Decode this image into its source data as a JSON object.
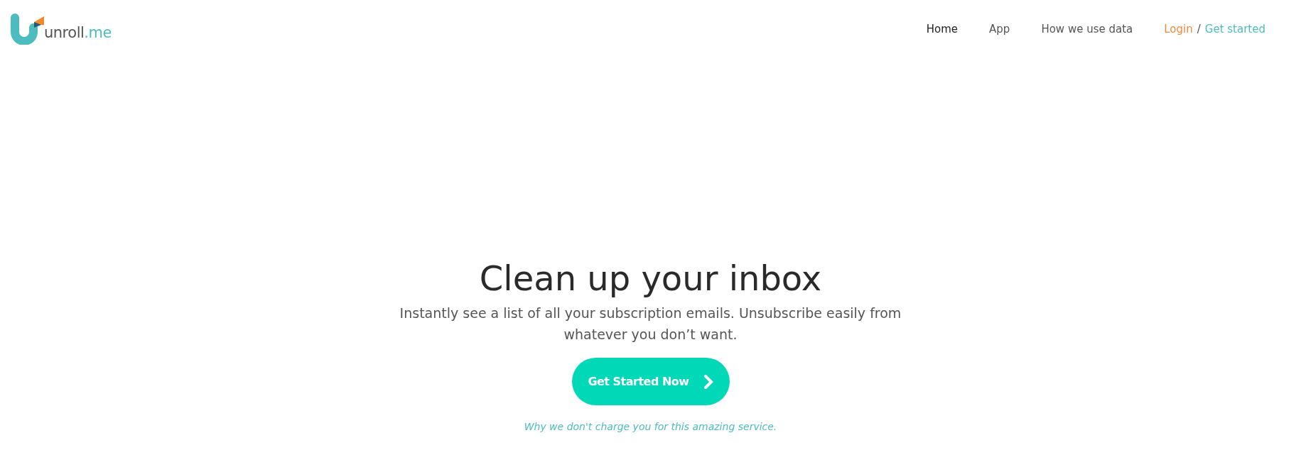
{
  "logo": {
    "text": "unroll",
    "suffix": ".me"
  },
  "nav": [
    {
      "label": "Home",
      "selected": true
    },
    {
      "label": "App",
      "selected": false
    },
    {
      "label": "How we use data",
      "selected": false
    }
  ],
  "auth": {
    "login": "Login",
    "separator": "/",
    "signup": "Get started"
  },
  "hero": {
    "title": "Clean up your inbox",
    "subtitle": "Instantly see a list of all your subscription emails. Unsubscribe easily from whatever you don’t want.",
    "button": "Get Started Now",
    "note": "Why we don't charge you for this amazing service."
  }
}
